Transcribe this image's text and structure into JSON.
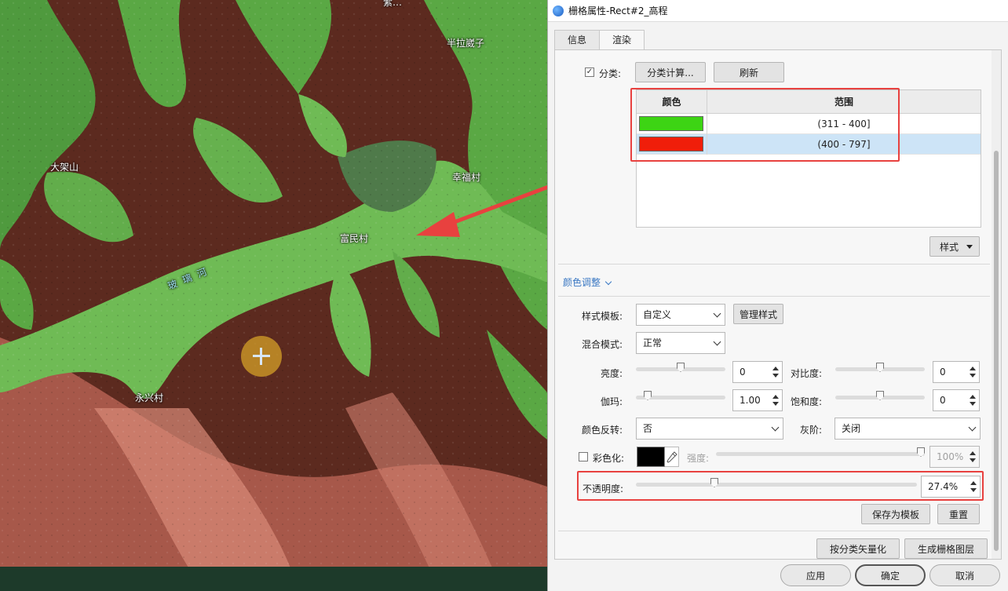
{
  "map": {
    "labels": {
      "top": "紫…",
      "banlaraizi": "半拉崴子",
      "dajiashan": "大架山",
      "xingfucun": "幸福村",
      "fumincun": "富民村",
      "river": "玻璃河",
      "yongxingcun": "永兴村"
    }
  },
  "dialog": {
    "title": "栅格属性-Rect#2_高程",
    "tabs": [
      "信息",
      "渲染"
    ],
    "active_tab": "渲染",
    "classify": {
      "checkbox_label": "分类:",
      "checked": true,
      "compute_button": "分类计算...",
      "refresh_button": "刷新",
      "table": {
        "headers": [
          "颜色",
          "范围"
        ],
        "rows": [
          {
            "color": "#3dd414",
            "range": "(311 - 400]"
          },
          {
            "color": "#f01e0a",
            "range": "(400 - 797]"
          }
        ],
        "selected_row": 1
      },
      "style_button": "样式"
    },
    "color_adjust": {
      "title": "颜色调整",
      "style_template_label": "样式模板:",
      "style_template_value": "自定义",
      "manage_style_button": "管理样式",
      "blend_mode_label": "混合模式:",
      "blend_mode_value": "正常",
      "brightness_label": "亮度:",
      "brightness_value": "0",
      "contrast_label": "对比度:",
      "contrast_value": "0",
      "gamma_label": "伽玛:",
      "gamma_value": "1.00",
      "saturation_label": "饱和度:",
      "saturation_value": "0",
      "invert_label": "颜色反转:",
      "invert_value": "否",
      "grayscale_label": "灰阶:",
      "grayscale_value": "关闭",
      "colorize_label": "彩色化:",
      "colorize_checked": false,
      "colorize_color": "#000000",
      "strength_label": "强度:",
      "strength_value": "100%",
      "opacity_label": "不透明度:",
      "opacity_value": "27.4%",
      "save_template_button": "保存为模板",
      "reset_button": "重置"
    },
    "vectorize_button": "按分类矢量化",
    "generate_raster_button": "生成栅格图层",
    "apply_button": "应用",
    "ok_button": "确定",
    "cancel_button": "取消"
  },
  "highlight_color": "#e8413f"
}
